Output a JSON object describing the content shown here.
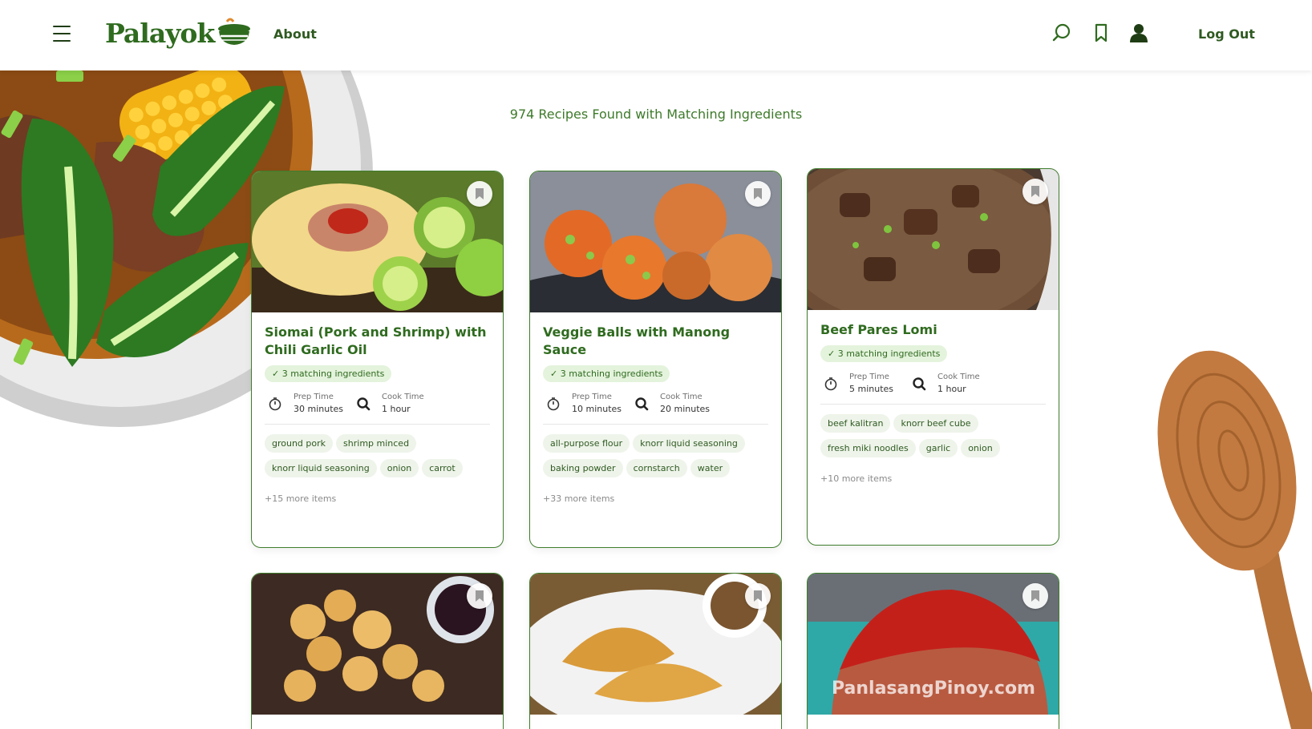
{
  "header": {
    "logo_text": "Palayok",
    "nav_about": "About",
    "logout_label": "Log Out",
    "icons": [
      "menu-icon",
      "search-icon",
      "bookmark-icon",
      "user-icon"
    ]
  },
  "results": {
    "count_text": "974 Recipes Found with Matching Ingredients"
  },
  "labels": {
    "prep_time": "Prep Time",
    "cook_time": "Cook Time"
  },
  "recipes": [
    {
      "title": "Siomai (Pork and Shrimp) with Chili Garlic Oil",
      "badge": "✓ 3 matching ingredients",
      "prep": "30 minutes",
      "cook": "1 hour",
      "ingredients": [
        "ground pork",
        "shrimp minced",
        "knorr liquid seasoning",
        "onion",
        "carrot"
      ],
      "more": "+15 more items"
    },
    {
      "title": "Veggie Balls with Manong Sauce",
      "badge": "✓ 3 matching ingredients",
      "prep": "10 minutes",
      "cook": "20 minutes",
      "ingredients": [
        "all-purpose flour",
        "knorr liquid seasoning",
        "baking powder",
        "cornstarch",
        "water"
      ],
      "more": "+33 more items"
    },
    {
      "title": "Beef Pares Lomi",
      "badge": "✓ 3 matching ingredients",
      "prep": "5 minutes",
      "cook": "1 hour",
      "ingredients": [
        "beef kalitran",
        "knorr beef cube",
        "fresh miki noodles",
        "garlic",
        "onion"
      ],
      "more": "+10 more items"
    },
    {
      "image_watermark": ""
    },
    {
      "image_watermark": ""
    },
    {
      "image_watermark": "PanlasangPinoy.com"
    }
  ],
  "colors": {
    "brand_green": "#2f6b1f",
    "badge_bg": "#e4f3dc",
    "chip_bg": "#eef4ea",
    "card_border": "#3f7d2c"
  }
}
